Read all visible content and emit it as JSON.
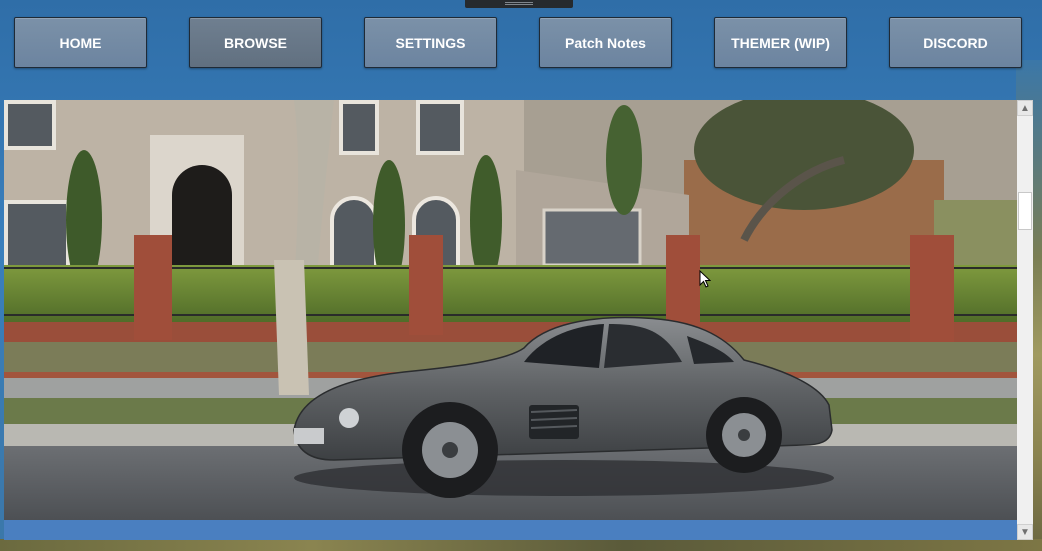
{
  "nav": {
    "items": [
      {
        "label": "HOME"
      },
      {
        "label": "BROWSE",
        "active": true
      },
      {
        "label": "SETTINGS"
      },
      {
        "label": "Patch Notes"
      },
      {
        "label": "THEMER (WIP)"
      },
      {
        "label": "DISCORD"
      }
    ]
  },
  "colors": {
    "background": "#3a7fbc",
    "nav_button": "#7b91a8",
    "nav_button_active": "#6f7f90",
    "footer_bar": "#4a7fc0",
    "car_body": "#5f6265"
  },
  "icons": {
    "scroll_up": "▲",
    "scroll_down": "▼"
  }
}
